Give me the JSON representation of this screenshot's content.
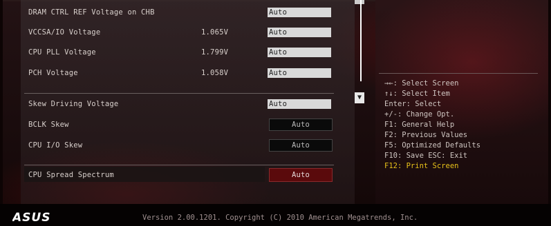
{
  "settings": [
    {
      "label": "DRAM CTRL REF Voltage on CHB",
      "value": "",
      "option": "Auto"
    },
    {
      "label": "VCCSA/IO Voltage",
      "value": "1.065V",
      "option": "Auto"
    },
    {
      "label": "CPU PLL Voltage",
      "value": "1.799V",
      "option": "Auto"
    },
    {
      "label": "PCH Voltage",
      "value": "1.058V",
      "option": "Auto"
    },
    {
      "label": "Skew Driving Voltage",
      "value": "",
      "option": "Auto"
    },
    {
      "label": "BCLK Skew",
      "value": "",
      "option": "Auto"
    },
    {
      "label": "CPU I/O Skew",
      "value": "",
      "option": "Auto"
    },
    {
      "label": "CPU Spread Spectrum",
      "value": "",
      "option": "Auto"
    }
  ],
  "help": {
    "select_screen": "→←: Select Screen",
    "select_item": "↑↓: Select Item",
    "enter": "Enter: Select",
    "change": "+/-: Change Opt.",
    "f1": "F1: General Help",
    "f2": "F2: Previous Values",
    "f5": "F5: Optimized Defaults",
    "f10": "F10: Save  ESC: Exit",
    "f12": "F12: Print Screen"
  },
  "footer": {
    "brand": "ASUS",
    "version": "Version 2.00.1201. Copyright (C) 2010 American Megatrends, Inc."
  },
  "colors": {
    "highlight_yellow": "#e8c21a",
    "selected_red": "#5a0a0c"
  },
  "icons": {
    "scroll_down": "arrow-down-icon"
  }
}
